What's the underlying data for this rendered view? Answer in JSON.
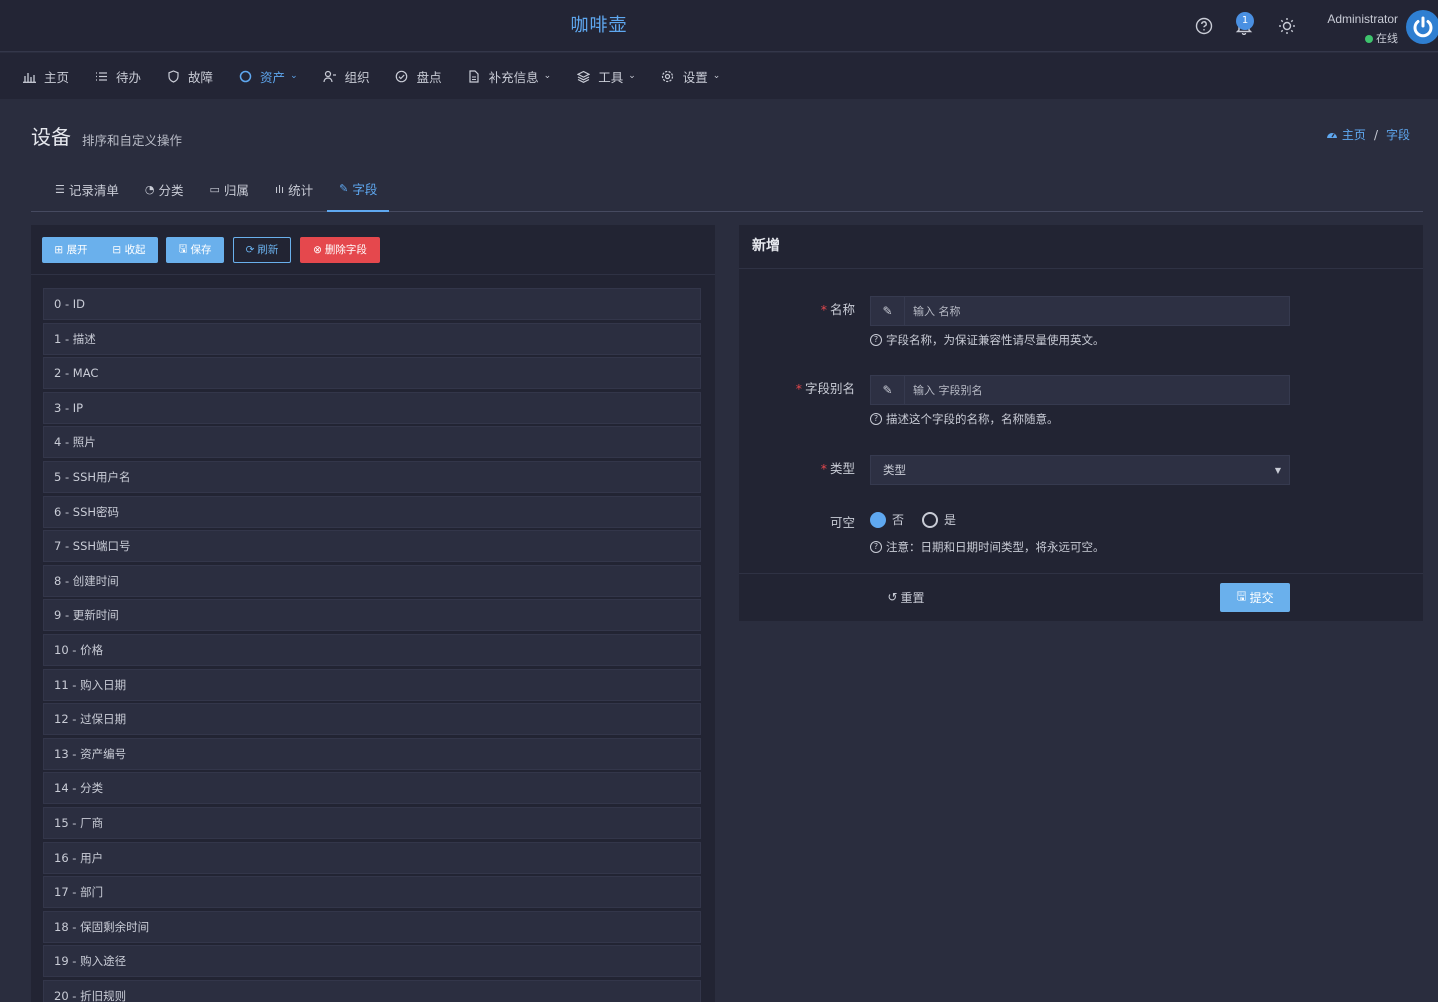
{
  "header": {
    "app_title": "咖啡壶",
    "notification_count": "1",
    "user_name": "Administrator",
    "user_status": "在线"
  },
  "nav": {
    "items": [
      {
        "label": "主页",
        "icon": "bar-chart-icon"
      },
      {
        "label": "待办",
        "icon": "list-icon"
      },
      {
        "label": "故障",
        "icon": "shield-icon"
      },
      {
        "label": "资产",
        "icon": "circle-icon",
        "active": true
      },
      {
        "label": "组织",
        "icon": "user-plus-icon"
      },
      {
        "label": "盘点",
        "icon": "check-circle-icon"
      },
      {
        "label": "补充信息",
        "icon": "document-icon"
      },
      {
        "label": "工具",
        "icon": "layers-icon"
      },
      {
        "label": "设置",
        "icon": "gear-icon"
      }
    ]
  },
  "page": {
    "title": "设备",
    "subtitle": "排序和自定义操作",
    "breadcrumb": {
      "home": "主页",
      "current": "字段"
    }
  },
  "tabs": [
    {
      "label": "记录清单",
      "icon": "list-icon"
    },
    {
      "label": "分类",
      "icon": "pie-icon"
    },
    {
      "label": "归属",
      "icon": "archive-icon"
    },
    {
      "label": "统计",
      "icon": "bar-chart-icon"
    },
    {
      "label": "字段",
      "icon": "pencil-icon",
      "active": true
    }
  ],
  "toolbar": {
    "expand": "展开",
    "collapse": "收起",
    "save": "保存",
    "refresh": "刷新",
    "delete_field": "删除字段"
  },
  "fields": [
    "0 - ID",
    "1 - 描述",
    "2 - MAC",
    "3 - IP",
    "4 - 照片",
    "5 - SSH用户名",
    "6 - SSH密码",
    "7 - SSH端口号",
    "8 - 创建时间",
    "9 - 更新时间",
    "10 - 价格",
    "11 - 购入日期",
    "12 - 过保日期",
    "13 - 资产编号",
    "14 - 分类",
    "15 - 厂商",
    "16 - 用户",
    "17 - 部门",
    "18 - 保固剩余时间",
    "19 - 购入途径",
    "20 - 折旧规则"
  ],
  "form": {
    "title": "新增",
    "name_label": "名称",
    "name_placeholder": "输入 名称",
    "name_help": "字段名称，为保证兼容性请尽量使用英文。",
    "alias_label": "字段别名",
    "alias_placeholder": "输入 字段别名",
    "alias_help": "描述这个字段的名称，名称随意。",
    "type_label": "类型",
    "type_value": "类型",
    "nullable_label": "可空",
    "nullable_no": "否",
    "nullable_yes": "是",
    "nullable_selected": "否",
    "nullable_help": "注意：日期和日期时间类型，将永远可空。",
    "reset": "重置",
    "submit": "提交"
  },
  "colors": {
    "accent": "#5fa8f0",
    "danger": "#e5484d",
    "online": "#3ec46d",
    "background": "#2a2d3e"
  }
}
